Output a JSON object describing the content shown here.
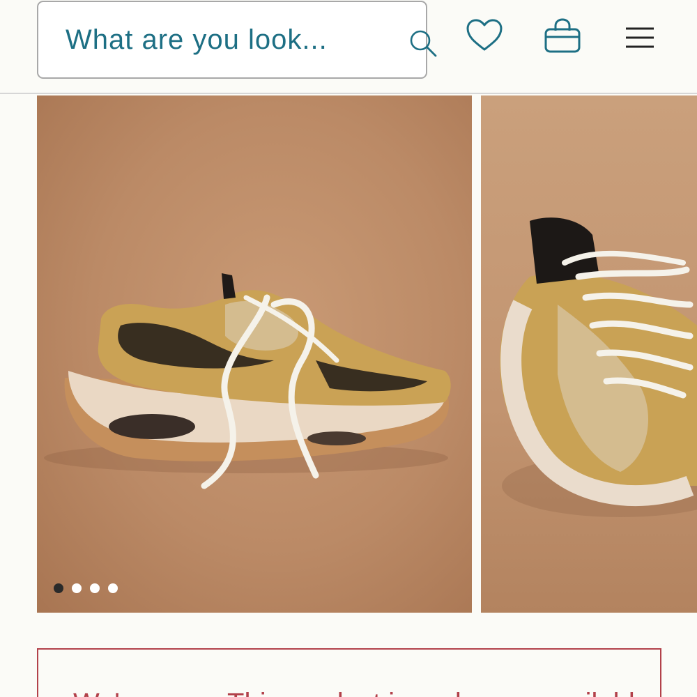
{
  "header": {
    "search": {
      "placeholder": "What are you look..."
    },
    "icons": {
      "search": "search-icon",
      "wishlist": "heart-icon",
      "bag": "shopping-bag-icon",
      "menu": "hamburger-menu-icon"
    }
  },
  "gallery": {
    "slides": [
      {
        "subject": "gold-and-black-mesh-sneaker-side-view"
      },
      {
        "subject": "gold-and-black-mesh-sneaker-front-angle"
      }
    ],
    "dots": {
      "count": 4,
      "active_index": 0
    }
  },
  "notice": {
    "text": "We're sorry. This product is no longer available."
  },
  "colors": {
    "accent": "#1d6f84",
    "notice": "#b2414a",
    "background": "#fbfbf7"
  }
}
